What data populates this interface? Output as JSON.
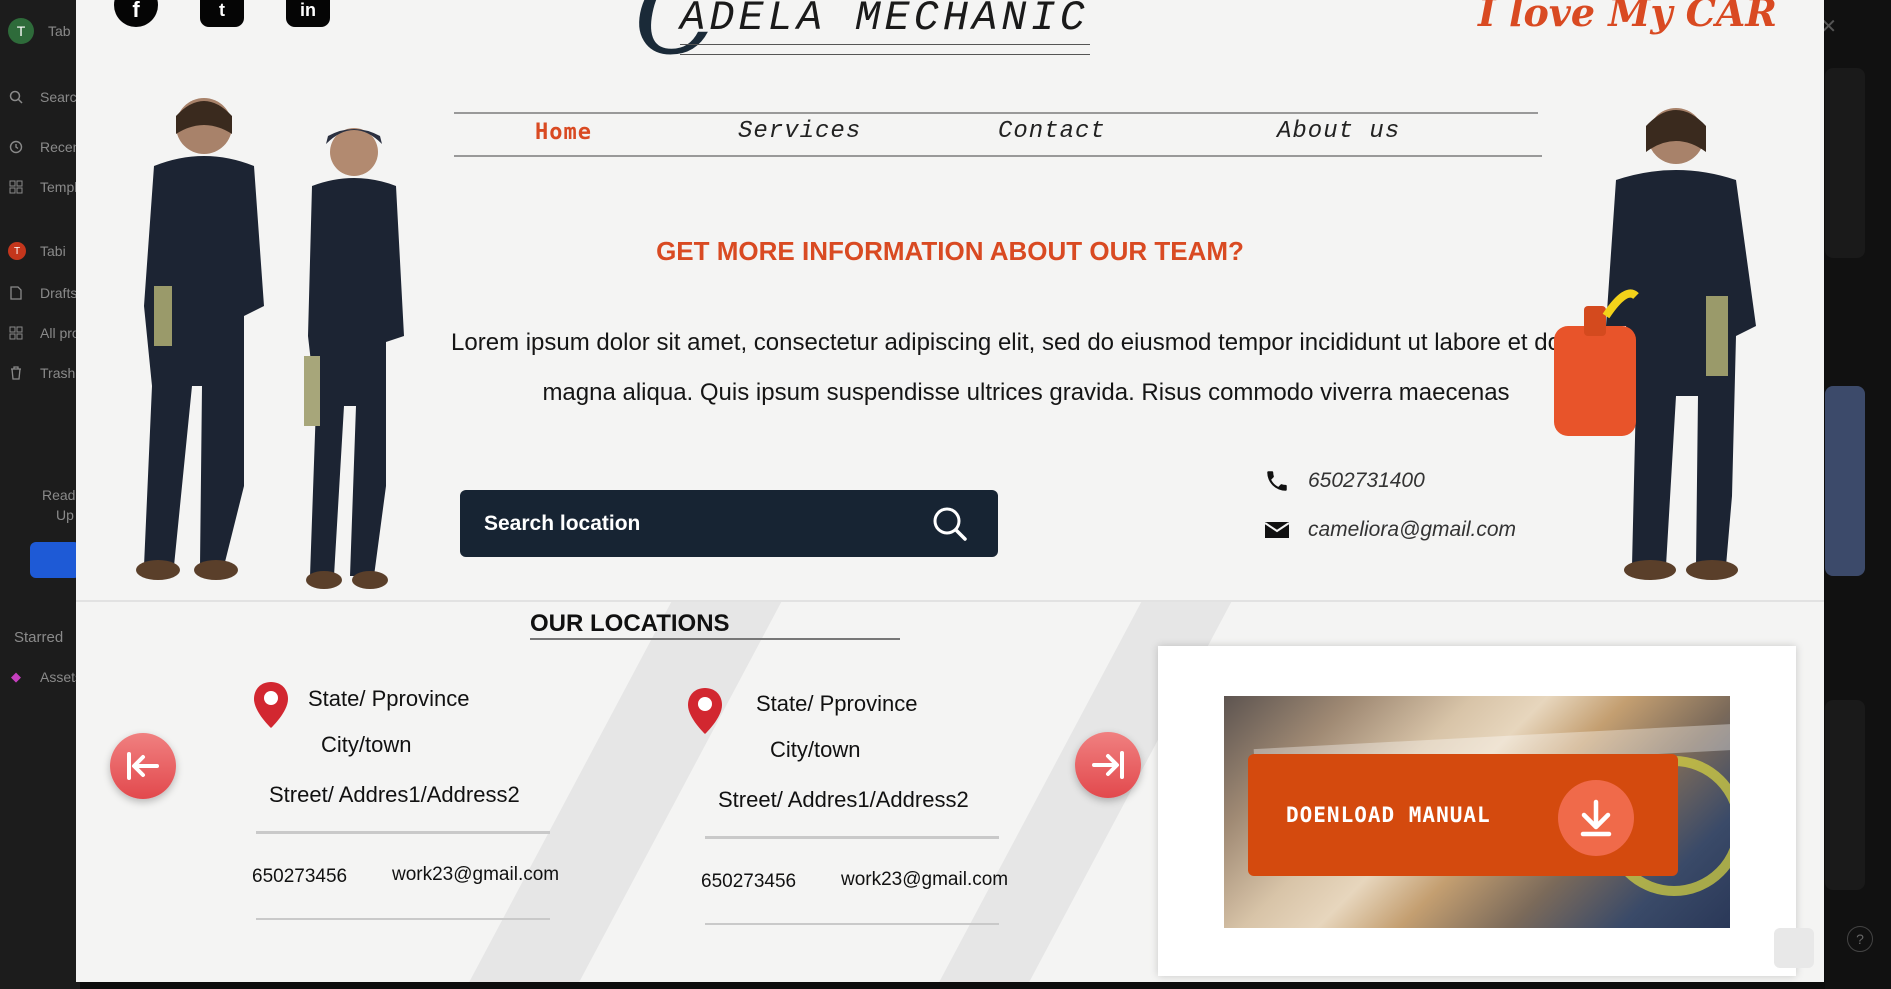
{
  "background_app": {
    "sidebar_items": [
      {
        "label": "Tab",
        "icon": "avatar"
      },
      {
        "label": "Search",
        "icon": "search-icon"
      },
      {
        "label": "Recents",
        "icon": "clock-icon"
      },
      {
        "label": "Templates",
        "icon": "grid-icon"
      },
      {
        "label": "Tabi",
        "icon": "team-icon"
      },
      {
        "label": "Drafts",
        "icon": "file-icon"
      },
      {
        "label": "All projects",
        "icon": "grid-icon"
      },
      {
        "label": "Trash",
        "icon": "trash-icon"
      }
    ],
    "upgrade_text_1": "Read",
    "upgrade_text_2": "Up",
    "starred_label": "Starred",
    "starred_item": "Assets",
    "avatar_letter": "T",
    "team_letter": "T"
  },
  "header": {
    "logo_text": "ADELA MECHANIC",
    "tagline": "I love My CAR",
    "social": [
      "f",
      "t",
      "in"
    ]
  },
  "nav": {
    "items": [
      "Home",
      "Services",
      "Contact",
      "About us"
    ],
    "active": "Home"
  },
  "hero": {
    "heading": "GET MORE INFORMATION ABOUT OUR TEAM?",
    "paragraph": "Lorem ipsum dolor sit amet, consectetur adipiscing elit, sed do eiusmod tempor incididunt ut labore et dolore magna aliqua. Quis ipsum suspendisse ultrices gravida. Risus commodo viverra maecenas"
  },
  "search": {
    "placeholder": "Search location"
  },
  "contact": {
    "phone": "6502731400",
    "email": "cameliora@gmail.com"
  },
  "locations": {
    "title": "OUR LOCATIONS",
    "cards": [
      {
        "state": "State/ Pprovince",
        "city": "City/town",
        "street": "Street/ Addres1/Address2",
        "phone": "650273456",
        "email": "work23@gmail.com"
      },
      {
        "state": "State/ Pprovince",
        "city": "City/town",
        "street": "Street/ Addres1/Address2",
        "phone": "650273456",
        "email": "work23@gmail.com"
      }
    ]
  },
  "download": {
    "label": "DOENLOAD MANUAL"
  },
  "colors": {
    "accent": "#d94a22",
    "dark": "#172433",
    "frame_bg": "#f4f4f3",
    "arrow": "#e2494d"
  }
}
